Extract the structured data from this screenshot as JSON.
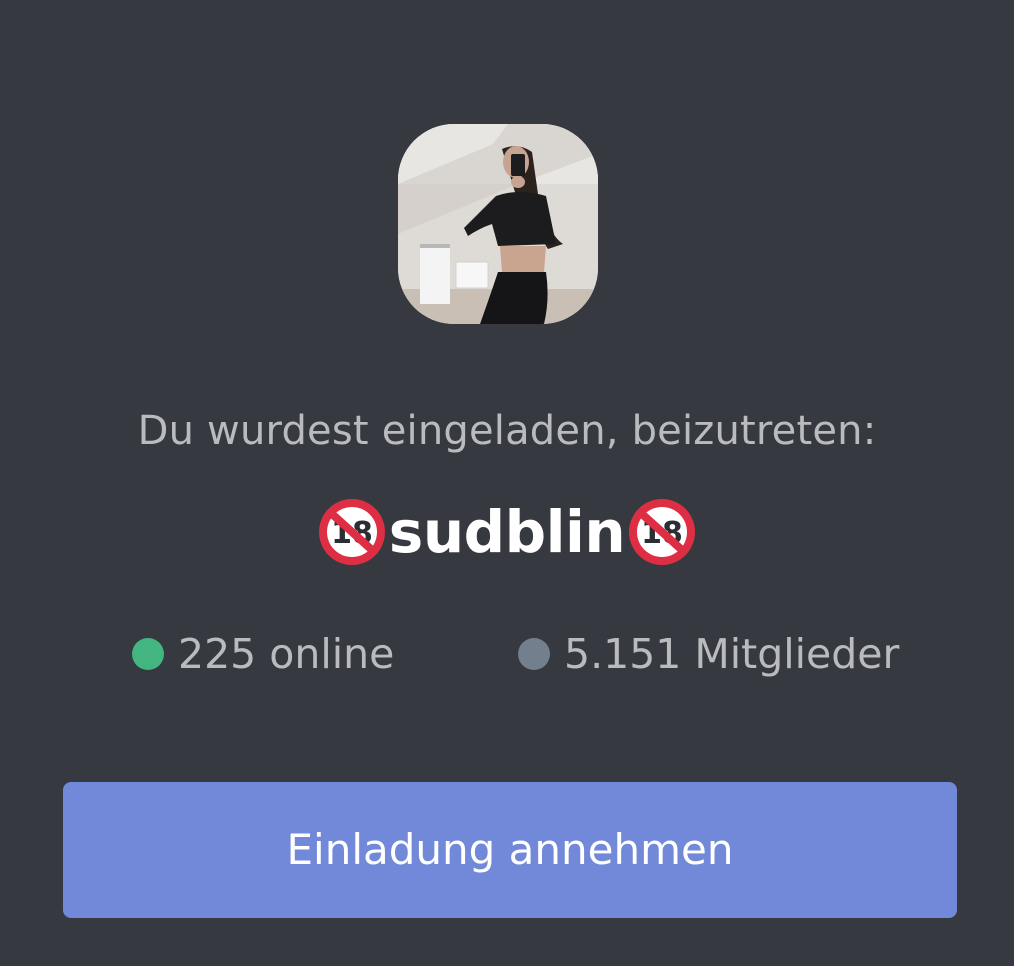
{
  "invite": {
    "heading": "Du wurdest eingeladen, beizutreten:",
    "server_name": "sudblin",
    "server_icon": "server-avatar-photo",
    "badge_icon": "no-under-18-emoji",
    "online_count": "225 online",
    "member_count": "5.151 Mitglieder",
    "accept_label": "Einladung annehmen"
  },
  "colors": {
    "background": "#36393f",
    "button": "#7289da",
    "online_dot": "#43b581",
    "members_dot": "#747f8d",
    "text_muted": "#b9bbbe",
    "text_primary": "#ffffff",
    "badge_red": "#dd2e44"
  }
}
